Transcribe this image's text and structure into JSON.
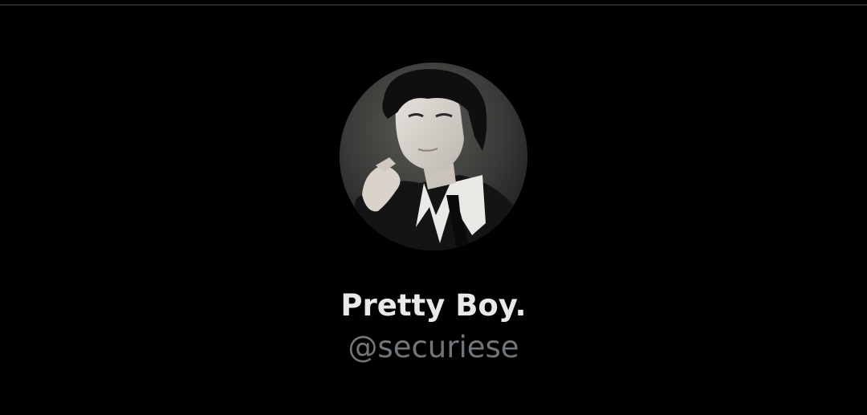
{
  "profile": {
    "display_name": "Pretty Boy.",
    "handle": "@securiese",
    "avatar_alt": "profile photo"
  },
  "colors": {
    "background": "#000000",
    "name_text": "#e7e9ea",
    "handle_text": "#71767b"
  }
}
